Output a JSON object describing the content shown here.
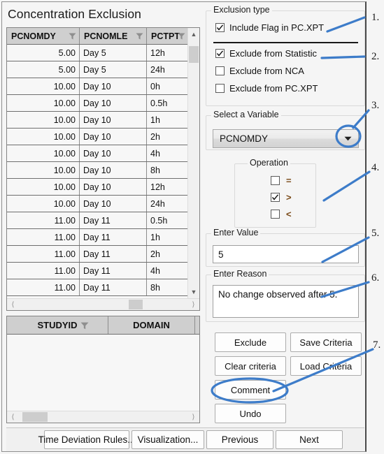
{
  "window": {
    "title": "Concentration Exclusion"
  },
  "grid1": {
    "columns": [
      {
        "label": "PCNOMDY",
        "has_filter": true
      },
      {
        "label": "PCNOMLE",
        "has_filter": true
      },
      {
        "label": "PCTPT",
        "has_filter": true
      }
    ],
    "rows": [
      {
        "pcnomdy": "5.00",
        "pcnomle": "Day 5",
        "pctpt": "12h"
      },
      {
        "pcnomdy": "5.00",
        "pcnomle": "Day 5",
        "pctpt": "24h"
      },
      {
        "pcnomdy": "10.00",
        "pcnomle": "Day 10",
        "pctpt": "0h"
      },
      {
        "pcnomdy": "10.00",
        "pcnomle": "Day 10",
        "pctpt": "0.5h"
      },
      {
        "pcnomdy": "10.00",
        "pcnomle": "Day 10",
        "pctpt": "1h"
      },
      {
        "pcnomdy": "10.00",
        "pcnomle": "Day 10",
        "pctpt": "2h"
      },
      {
        "pcnomdy": "10.00",
        "pcnomle": "Day 10",
        "pctpt": "4h"
      },
      {
        "pcnomdy": "10.00",
        "pcnomle": "Day 10",
        "pctpt": "8h"
      },
      {
        "pcnomdy": "10.00",
        "pcnomle": "Day 10",
        "pctpt": "12h"
      },
      {
        "pcnomdy": "10.00",
        "pcnomle": "Day 10",
        "pctpt": "24h"
      },
      {
        "pcnomdy": "11.00",
        "pcnomle": "Day 11",
        "pctpt": "0.5h"
      },
      {
        "pcnomdy": "11.00",
        "pcnomle": "Day 11",
        "pctpt": "1h"
      },
      {
        "pcnomdy": "11.00",
        "pcnomle": "Day 11",
        "pctpt": "2h"
      },
      {
        "pcnomdy": "11.00",
        "pcnomle": "Day 11",
        "pctpt": "4h"
      },
      {
        "pcnomdy": "11.00",
        "pcnomle": "Day 11",
        "pctpt": "8h"
      }
    ]
  },
  "grid2": {
    "columns": [
      {
        "label": "STUDYID",
        "has_filter": true
      },
      {
        "label": "DOMAIN",
        "has_filter": false
      }
    ],
    "rows": []
  },
  "exclusion_type": {
    "legend": "Exclusion type",
    "options": [
      {
        "label": "Include Flag in PC.XPT",
        "checked": true
      },
      {
        "label": "Exclude from Statistic",
        "checked": true
      },
      {
        "label": "Exclude from NCA",
        "checked": false
      },
      {
        "label": "Exclude from PC.XPT",
        "checked": false
      }
    ]
  },
  "select_variable": {
    "legend": "Select a Variable",
    "selected": "PCNOMDY"
  },
  "operation": {
    "legend": "Operation",
    "options": [
      {
        "symbol": "=",
        "checked": false
      },
      {
        "symbol": ">",
        "checked": true
      },
      {
        "symbol": "<",
        "checked": false
      }
    ]
  },
  "enter_value": {
    "legend": "Enter Value",
    "value": "5",
    "placeholder": ""
  },
  "enter_reason": {
    "legend": "Enter Reason",
    "value": "No change observed after 5.",
    "placeholder": ""
  },
  "actions": {
    "exclude": "Exclude",
    "save_criteria": "Save Criteria",
    "clear_criteria": "Clear criteria",
    "load_criteria": "Load Criteria",
    "comment": "Comment",
    "undo": "Undo"
  },
  "bottom_bar": {
    "time_deviation_rules": "Time Deviation Rules...",
    "visualization": "Visualization...",
    "previous": "Previous",
    "next": "Next"
  },
  "annotations": {
    "accent_color": "#3d7cc9",
    "items": [
      {
        "number": "1."
      },
      {
        "number": "2."
      },
      {
        "number": "3."
      },
      {
        "number": "4."
      },
      {
        "number": "5."
      },
      {
        "number": "6."
      },
      {
        "number": "7."
      }
    ]
  }
}
